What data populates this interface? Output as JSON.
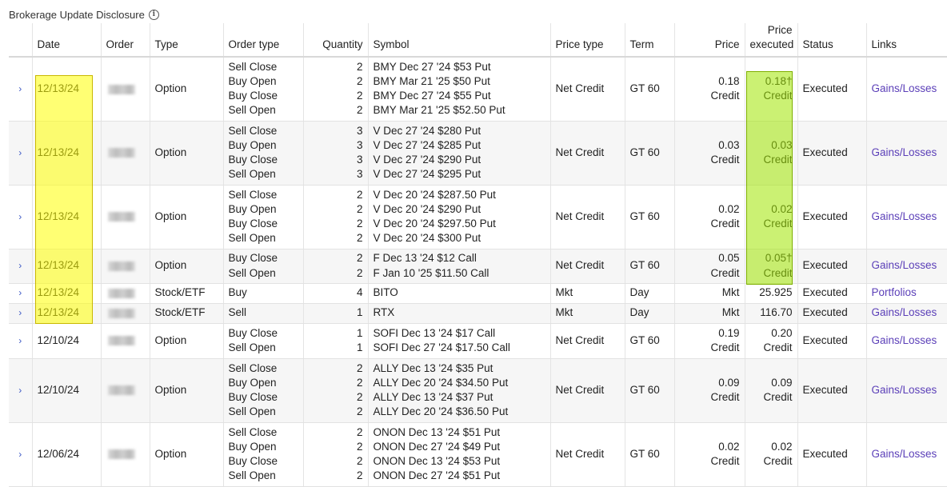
{
  "disclosure": {
    "label": "Brokerage Update Disclosure",
    "info_icon": "i"
  },
  "headers": {
    "date": "Date",
    "order": "Order",
    "type": "Type",
    "order_type": "Order type",
    "quantity": "Quantity",
    "symbol": "Symbol",
    "price_type": "Price type",
    "term": "Term",
    "price": "Price",
    "price_executed_1": "Price",
    "price_executed_2": "executed",
    "status": "Status",
    "links": "Links"
  },
  "colors": {
    "link": "#5b3fb8",
    "chevron": "#3b57c4",
    "date_highlight": "#ffff00",
    "price_highlight": "#a0e600"
  },
  "rows": [
    {
      "date": "12/13/24",
      "type": "Option",
      "order_types": [
        "Sell Close",
        "Buy Open",
        "Buy Close",
        "Sell Open"
      ],
      "quantities": [
        "2",
        "2",
        "2",
        "2"
      ],
      "symbols": [
        "BMY Dec 27 '24 $53 Put",
        "BMY Mar 21 '25 $50 Put",
        "BMY Dec 27 '24 $55 Put",
        "BMY Mar 21 '25 $52.50 Put"
      ],
      "price_type": "Net Credit",
      "term": "GT 60",
      "price": [
        "0.18",
        "Credit"
      ],
      "price_executed": [
        "0.18†",
        "Credit"
      ],
      "status": "Executed",
      "link": "Gains/Losses"
    },
    {
      "date": "12/13/24",
      "type": "Option",
      "order_types": [
        "Sell Close",
        "Buy Open",
        "Buy Close",
        "Sell Open"
      ],
      "quantities": [
        "3",
        "3",
        "3",
        "3"
      ],
      "symbols": [
        "V Dec 27 '24 $280 Put",
        "V Dec 27 '24 $285 Put",
        "V Dec 27 '24 $290 Put",
        "V Dec 27 '24 $295 Put"
      ],
      "price_type": "Net Credit",
      "term": "GT 60",
      "price": [
        "0.03",
        "Credit"
      ],
      "price_executed": [
        "0.03",
        "Credit"
      ],
      "status": "Executed",
      "link": "Gains/Losses"
    },
    {
      "date": "12/13/24",
      "type": "Option",
      "order_types": [
        "Sell Close",
        "Buy Open",
        "Buy Close",
        "Sell Open"
      ],
      "quantities": [
        "2",
        "2",
        "2",
        "2"
      ],
      "symbols": [
        "V Dec 20 '24 $287.50 Put",
        "V Dec 20 '24 $290 Put",
        "V Dec 20 '24 $297.50 Put",
        "V Dec 20 '24 $300 Put"
      ],
      "price_type": "Net Credit",
      "term": "GT 60",
      "price": [
        "0.02",
        "Credit"
      ],
      "price_executed": [
        "0.02",
        "Credit"
      ],
      "status": "Executed",
      "link": "Gains/Losses"
    },
    {
      "date": "12/13/24",
      "type": "Option",
      "order_types": [
        "Buy Close",
        "Sell Open"
      ],
      "quantities": [
        "2",
        "2"
      ],
      "symbols": [
        "F Dec 13 '24 $12 Call",
        "F Jan 10 '25 $11.50 Call"
      ],
      "price_type": "Net Credit",
      "term": "GT 60",
      "price": [
        "0.05",
        "Credit"
      ],
      "price_executed": [
        "0.05†",
        "Credit"
      ],
      "status": "Executed",
      "link": "Gains/Losses"
    },
    {
      "date": "12/13/24",
      "type": "Stock/ETF",
      "order_types": [
        "Buy"
      ],
      "quantities": [
        "4"
      ],
      "symbols": [
        "BITO"
      ],
      "price_type": "Mkt",
      "term": "Day",
      "price": [
        "Mkt"
      ],
      "price_executed": [
        "25.925"
      ],
      "status": "Executed",
      "link": "Portfolios"
    },
    {
      "date": "12/13/24",
      "type": "Stock/ETF",
      "order_types": [
        "Sell"
      ],
      "quantities": [
        "1"
      ],
      "symbols": [
        "RTX"
      ],
      "price_type": "Mkt",
      "term": "Day",
      "price": [
        "Mkt"
      ],
      "price_executed": [
        "116.70"
      ],
      "status": "Executed",
      "link": "Gains/Losses"
    },
    {
      "date": "12/10/24",
      "type": "Option",
      "order_types": [
        "Buy Close",
        "Sell Open"
      ],
      "quantities": [
        "1",
        "1"
      ],
      "symbols": [
        "SOFI Dec 13 '24 $17 Call",
        "SOFI Dec 27 '24 $17.50 Call"
      ],
      "price_type": "Net Credit",
      "term": "GT 60",
      "price": [
        "0.19",
        "Credit"
      ],
      "price_executed": [
        "0.20",
        "Credit"
      ],
      "status": "Executed",
      "link": "Gains/Losses"
    },
    {
      "date": "12/10/24",
      "type": "Option",
      "order_types": [
        "Sell Close",
        "Buy Open",
        "Buy Close",
        "Sell Open"
      ],
      "quantities": [
        "2",
        "2",
        "2",
        "2"
      ],
      "symbols": [
        "ALLY Dec 13 '24 $35 Put",
        "ALLY Dec 20 '24 $34.50 Put",
        "ALLY Dec 13 '24 $37 Put",
        "ALLY Dec 20 '24 $36.50 Put"
      ],
      "price_type": "Net Credit",
      "term": "GT 60",
      "price": [
        "0.09",
        "Credit"
      ],
      "price_executed": [
        "0.09",
        "Credit"
      ],
      "status": "Executed",
      "link": "Gains/Losses"
    },
    {
      "date": "12/06/24",
      "type": "Option",
      "order_types": [
        "Sell Close",
        "Buy Open",
        "Buy Close",
        "Sell Open"
      ],
      "quantities": [
        "2",
        "2",
        "2",
        "2"
      ],
      "symbols": [
        "ONON Dec 13 '24 $51 Put",
        "ONON Dec 27 '24 $49 Put",
        "ONON Dec 13 '24 $53 Put",
        "ONON Dec 27 '24 $51 Put"
      ],
      "price_type": "Net Credit",
      "term": "GT 60",
      "price": [
        "0.02",
        "Credit"
      ],
      "price_executed": [
        "0.02",
        "Credit"
      ],
      "status": "Executed",
      "link": "Gains/Losses"
    }
  ]
}
